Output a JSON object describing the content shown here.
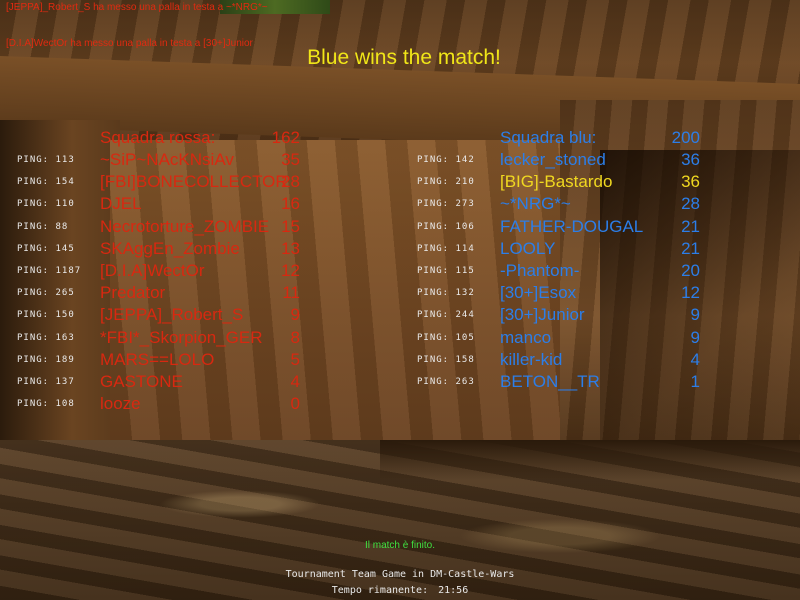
{
  "messages": [
    "[JEPPA]_Robert_S ha messo una palla in testa a ~*NRG*~",
    "[D.I.A]WectOr ha messo una palla in testa a [30+]Junior"
  ],
  "banner": "Blue wins the match!",
  "red_team": {
    "header_name": "Squadra rossa:",
    "header_score": "162",
    "color": "#d82810",
    "players": [
      {
        "ping_label": "PING:",
        "ping": "113",
        "name": "~SiP~NAcKNsiAv",
        "score": "35"
      },
      {
        "ping_label": "PING:",
        "ping": "154",
        "name": "[FBI]BONECOLLECTOR",
        "score": "28"
      },
      {
        "ping_label": "PING:",
        "ping": "110",
        "name": "DJEL",
        "score": "16"
      },
      {
        "ping_label": "PING:",
        "ping": "88",
        "name": "Necrotorture_ZOMBIE",
        "score": "15"
      },
      {
        "ping_label": "PING:",
        "ping": "145",
        "name": "SKAggEn_Zombie",
        "score": "13"
      },
      {
        "ping_label": "PING:",
        "ping": "1187",
        "name": "[D.I.A]WectOr",
        "score": "12"
      },
      {
        "ping_label": "PING:",
        "ping": "265",
        "name": "Predator",
        "score": "11"
      },
      {
        "ping_label": "PING:",
        "ping": "150",
        "name": "[JEPPA]_Robert_S",
        "score": "9"
      },
      {
        "ping_label": "PING:",
        "ping": "163",
        "name": "*FBI*_Skorpion_GER",
        "score": "8"
      },
      {
        "ping_label": "PING:",
        "ping": "189",
        "name": "MARS==LOLO",
        "score": "5"
      },
      {
        "ping_label": "PING:",
        "ping": "137",
        "name": "GASTONE",
        "score": "4"
      },
      {
        "ping_label": "PING:",
        "ping": "108",
        "name": "looze",
        "score": "0"
      }
    ]
  },
  "blue_team": {
    "header_name": "Squadra blu:",
    "header_score": "200",
    "color": "#2c7ee8",
    "highlight_color": "#f0d820",
    "players": [
      {
        "ping_label": "PING:",
        "ping": "142",
        "name": "lecker_stoned",
        "score": "36",
        "highlight": false
      },
      {
        "ping_label": "PING:",
        "ping": "210",
        "name": "[BIG]-Bastardo",
        "score": "36",
        "highlight": true
      },
      {
        "ping_label": "PING:",
        "ping": "273",
        "name": "~*NRG*~",
        "score": "28",
        "highlight": false
      },
      {
        "ping_label": "PING:",
        "ping": "106",
        "name": "FATHER-DOUGAL",
        "score": "21",
        "highlight": false
      },
      {
        "ping_label": "PING:",
        "ping": "114",
        "name": "LOOLY",
        "score": "21",
        "highlight": false
      },
      {
        "ping_label": "PING:",
        "ping": "115",
        "name": "-Phantom-",
        "score": "20",
        "highlight": false
      },
      {
        "ping_label": "PING:",
        "ping": "132",
        "name": "[30+]Esox",
        "score": "12",
        "highlight": false
      },
      {
        "ping_label": "PING:",
        "ping": "244",
        "name": "[30+]Junior",
        "score": "9",
        "highlight": false
      },
      {
        "ping_label": "PING:",
        "ping": "105",
        "name": "manco",
        "score": "9",
        "highlight": false
      },
      {
        "ping_label": "PING:",
        "ping": "158",
        "name": "killer-kid",
        "score": "4",
        "highlight": false
      },
      {
        "ping_label": "PING:",
        "ping": "263",
        "name": "BETON__TR",
        "score": "1",
        "highlight": false
      }
    ]
  },
  "footer": {
    "finished": "Il match è finito.",
    "game_mode": "Tournament Team Game in DM-Castle-Wars",
    "time_label": "Tempo rimanente:",
    "time_value": "21:56"
  }
}
